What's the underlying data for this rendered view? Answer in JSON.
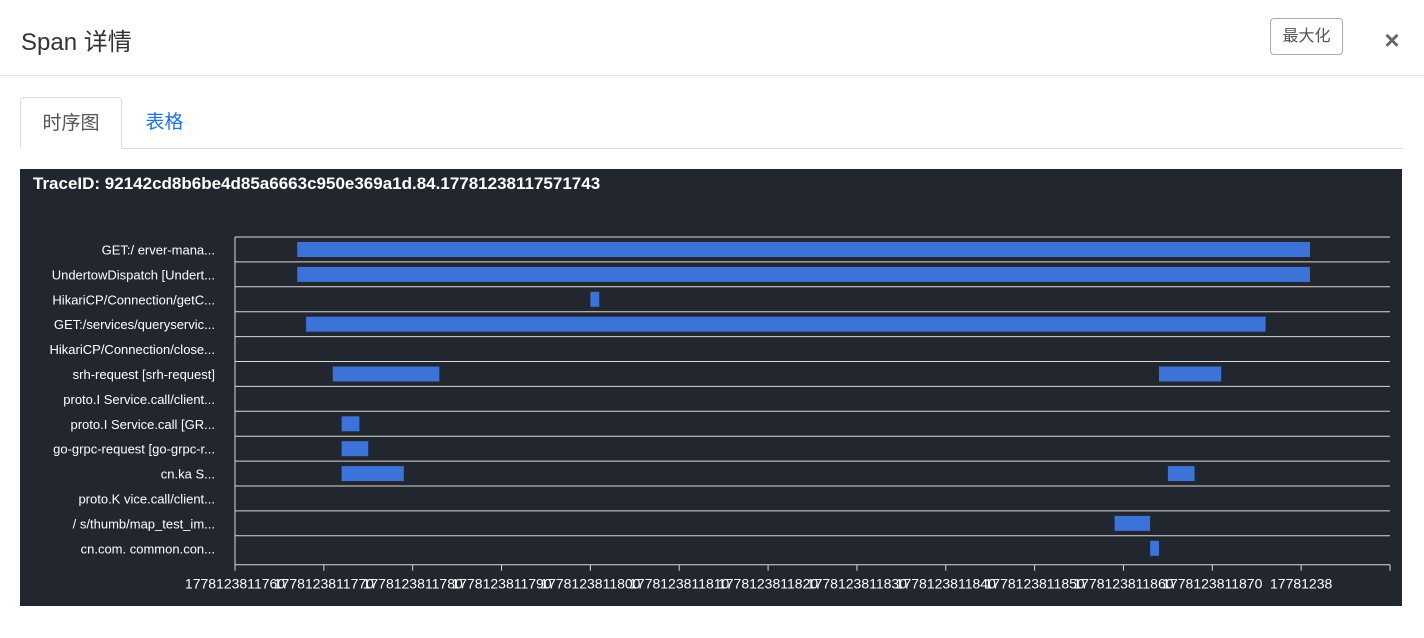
{
  "modal": {
    "title": "Span 详情",
    "maximize_label": "最大化",
    "close_glyph": "×"
  },
  "tabs": [
    {
      "label": "时序图",
      "active": true
    },
    {
      "label": "表格",
      "active": false
    }
  ],
  "colors": {
    "background": "#22262e",
    "bar": "#3b73d8",
    "grid": "#d9d9d9",
    "tab_link": "#1a73e8"
  },
  "chart_data": {
    "type": "timeline",
    "title": "TraceID: 92142cd8b6be4d85a6663c950e369a1d.84.17781238117571743",
    "x_ticks": [
      "1778123811760",
      "1778123811770",
      "1778123811780",
      "1778123811790",
      "1778123811800",
      "1778123811810",
      "1778123811820",
      "1778123811830",
      "1778123811840",
      "1778123811850",
      "1778123811860",
      "1778123811870",
      "17781238"
    ],
    "x_tick_values": [
      1778123811760,
      1778123811770,
      1778123811780,
      1778123811790,
      1778123811800,
      1778123811810,
      1778123811820,
      1778123811830,
      1778123811840,
      1778123811850,
      1778123811860,
      1778123811870,
      1778123811880
    ],
    "xlim": [
      1778123811760,
      1778123811890
    ],
    "spans": [
      {
        "label": "GET:/ erver-mana...",
        "segments": [
          [
            1778123811767.0,
            1778123811881.0
          ]
        ]
      },
      {
        "label": "UndertowDispatch [Undert...",
        "segments": [
          [
            1778123811767.0,
            1778123811881.0
          ]
        ]
      },
      {
        "label": "HikariCP/Connection/getC...",
        "segments": [
          [
            1778123811800.0,
            1778123811801.0
          ]
        ]
      },
      {
        "label": "GET:/services/queryservic...",
        "segments": [
          [
            1778123811768.0,
            1778123811876.0
          ]
        ]
      },
      {
        "label": "HikariCP/Connection/close...",
        "segments": []
      },
      {
        "label": "srh-request [srh-request]",
        "segments": [
          [
            1778123811771.0,
            1778123811783.0
          ],
          [
            1778123811864.0,
            1778123811871.0
          ]
        ]
      },
      {
        "label": "proto.I Service.call/client...",
        "segments": []
      },
      {
        "label": "proto.I Service.call [GR...",
        "segments": [
          [
            1778123811772.0,
            1778123811774.0
          ]
        ]
      },
      {
        "label": "go-grpc-request [go-grpc-r...",
        "segments": [
          [
            1778123811772.0,
            1778123811775.0
          ]
        ]
      },
      {
        "label": "cn.ka S...",
        "segments": [
          [
            1778123811772.0,
            1778123811779.0
          ],
          [
            1778123811865.0,
            1778123811868.0
          ]
        ]
      },
      {
        "label": "proto.K vice.call/client...",
        "segments": []
      },
      {
        "label": "/ s/thumb/map_test_im...",
        "segments": [
          [
            1778123811859.0,
            1778123811863.0
          ]
        ]
      },
      {
        "label": "cn.com. common.con...",
        "segments": [
          [
            1778123811863.0,
            1778123811864.0
          ]
        ]
      }
    ]
  }
}
